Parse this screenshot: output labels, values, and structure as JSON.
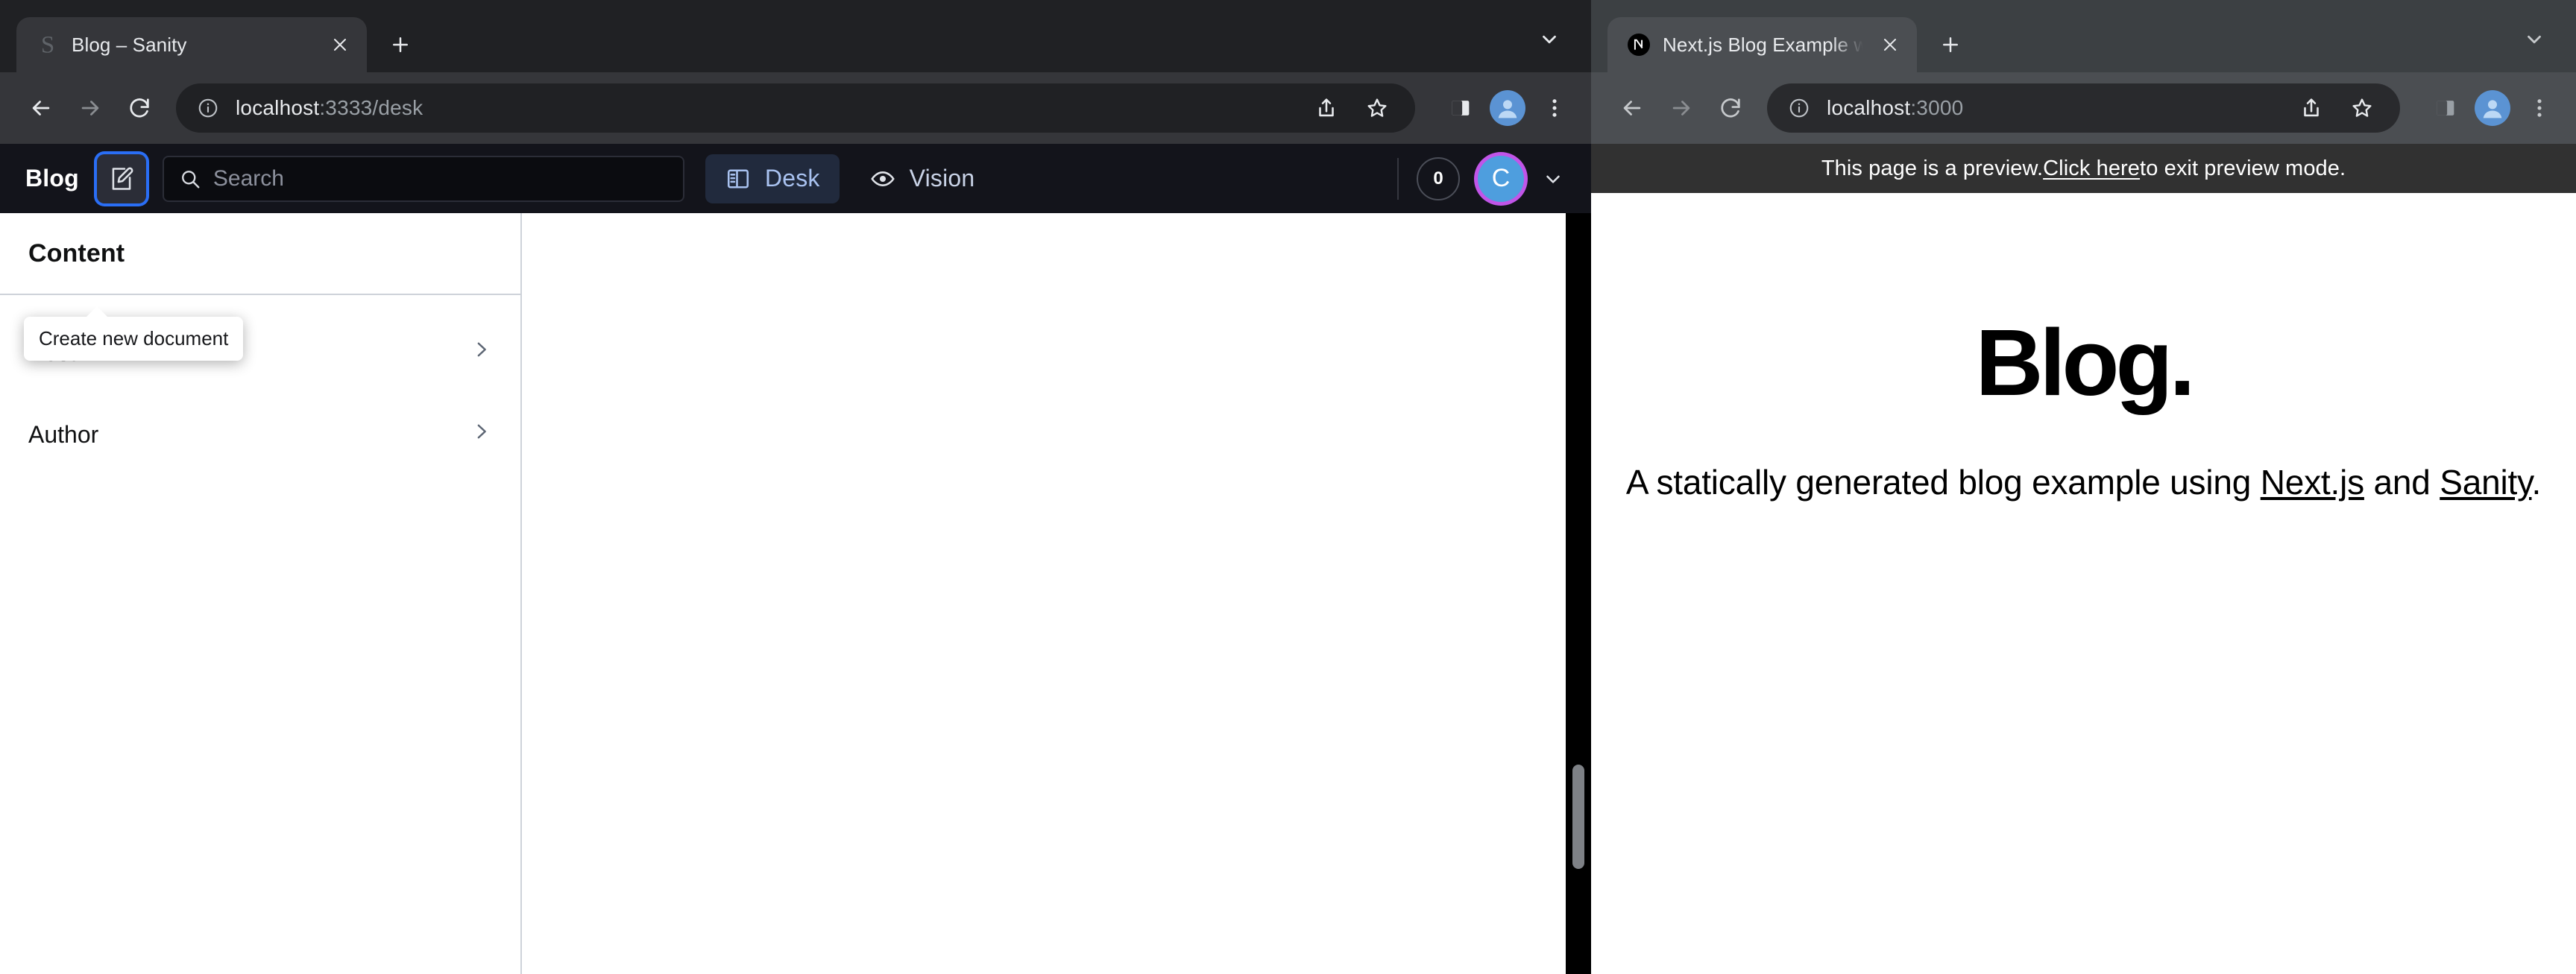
{
  "windows": {
    "left": {
      "tab": {
        "title": "Blog – Sanity",
        "favicon": "sanity-s-icon"
      },
      "omnibox": {
        "host": "localhost",
        "path": ":3333/desk",
        "security_icon": "info-circle-icon"
      },
      "toolbar_icons": [
        "back-icon",
        "forward-icon",
        "reload-icon",
        "share-icon",
        "bookmark-star-icon",
        "side-panel-icon",
        "profile-avatar-icon",
        "more-vert-icon"
      ]
    },
    "right": {
      "tab": {
        "title": "Next.js Blog Example with Sanit",
        "favicon": "nextjs-n-icon"
      },
      "omnibox": {
        "host": "localhost",
        "path": ":3000",
        "security_icon": "info-circle-icon"
      },
      "toolbar_icons": [
        "back-icon",
        "forward-icon",
        "reload-icon",
        "share-icon",
        "bookmark-star-icon",
        "side-panel-icon",
        "profile-avatar-icon",
        "more-vert-icon"
      ]
    }
  },
  "studio": {
    "brand": "Blog",
    "compose_tooltip": "Create new document",
    "search": {
      "placeholder": "Search",
      "value": ""
    },
    "tabs": [
      {
        "label": "Desk",
        "icon": "master-detail-icon",
        "active": true
      },
      {
        "label": "Vision",
        "icon": "eye-icon",
        "active": false
      }
    ],
    "presence_count": "0",
    "user_initial": "C",
    "pane": {
      "title": "Content",
      "items": [
        {
          "label": "Post",
          "chevron": "chevron-right-icon"
        },
        {
          "label": "Author",
          "chevron": "chevron-right-icon"
        }
      ]
    },
    "colors": {
      "accent": "#2a6ef5",
      "avatar_ring": "#c155e8",
      "avatar_bg": "#4e9ede",
      "nav_bg": "#13141b"
    }
  },
  "preview": {
    "banner": {
      "before": "This page is a preview. ",
      "link": "Click here",
      "after": " to exit preview mode."
    },
    "title": "Blog.",
    "subtitle": {
      "before": "A statically generated blog example using ",
      "link1": "Next.js",
      "middle": " and ",
      "link2": "Sanity",
      "after": "."
    }
  }
}
